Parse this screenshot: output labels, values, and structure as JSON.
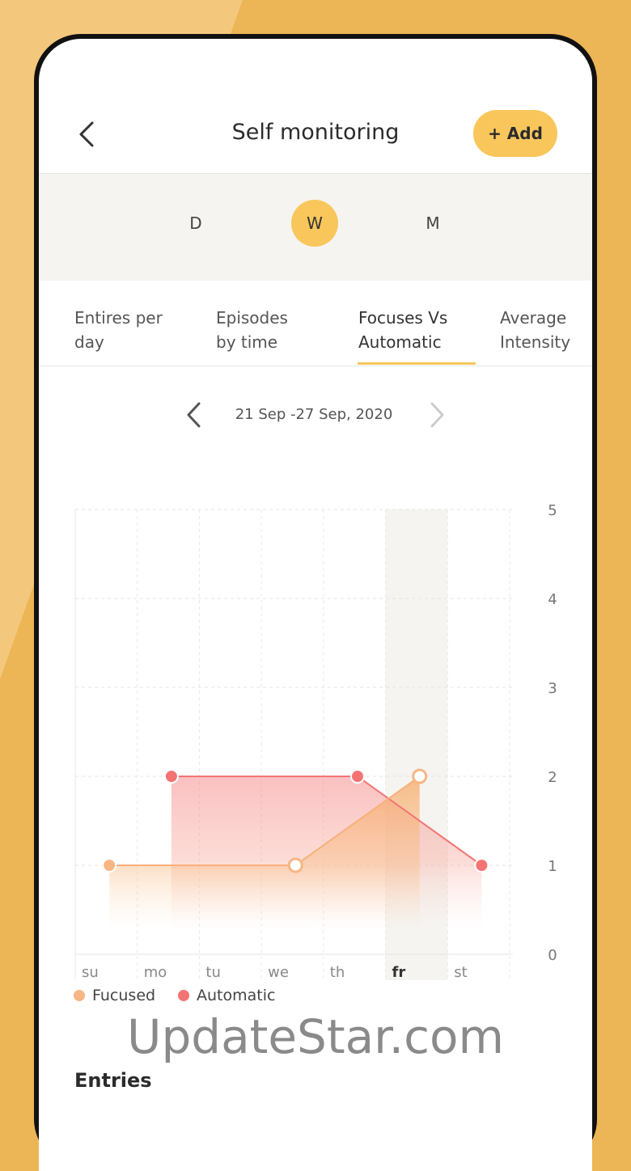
{
  "header": {
    "title": "Self monitoring",
    "add_label": "+ Add"
  },
  "periods": [
    {
      "label": "D",
      "active": false
    },
    {
      "label": "W",
      "active": true
    },
    {
      "label": "M",
      "active": false
    }
  ],
  "tabs": [
    {
      "line1": "Entires per",
      "line2": "day",
      "active": false
    },
    {
      "line1": "Episodes",
      "line2": "by time",
      "active": false
    },
    {
      "line1": "Focuses Vs",
      "line2": "Automatic",
      "active": true
    },
    {
      "line1": "Average",
      "line2": "Intensity",
      "active": false
    }
  ],
  "date_range": "21 Sep -27 Sep, 2020",
  "colors": {
    "accent": "#f8c65a",
    "focused": "#f7b684",
    "automatic": "#f47474",
    "highlight_band": "#f5f4f1"
  },
  "chart_data": {
    "type": "area",
    "categories": [
      "su",
      "mo",
      "tu",
      "we",
      "th",
      "fr",
      "st"
    ],
    "highlighted_category": "fr",
    "ylim": [
      0,
      5
    ],
    "y_ticks": [
      "0",
      "1",
      "2",
      "3",
      "4",
      "5"
    ],
    "y_axis_side": "right",
    "grid": true,
    "series": [
      {
        "name": "Fucused",
        "points": [
          {
            "x": "su",
            "y": 1
          },
          {
            "x": "we",
            "y": 1
          },
          {
            "x": "fr",
            "y": 2
          }
        ]
      },
      {
        "name": "Automatic",
        "points": [
          {
            "x": "mo",
            "y": 2
          },
          {
            "x": "th",
            "y": 2
          },
          {
            "x": "st",
            "y": 1
          }
        ]
      }
    ]
  },
  "legend": [
    {
      "label": "Fucused",
      "color": "#f7b684"
    },
    {
      "label": "Automatic",
      "color": "#f47474"
    }
  ],
  "watermark": "UpdateStar.com",
  "entries_title": "Entries"
}
